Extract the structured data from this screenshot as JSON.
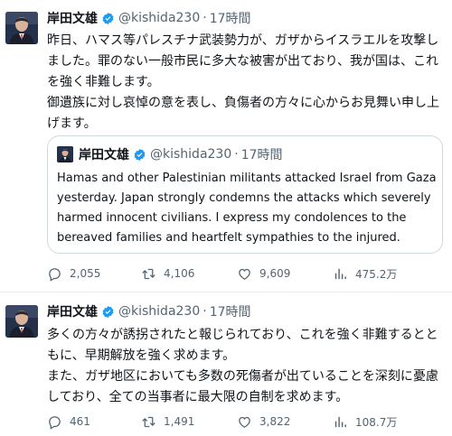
{
  "tweets": [
    {
      "author": {
        "name": "岸田文雄",
        "handle": "@kishida230",
        "time": "17時間"
      },
      "paragraphs": [
        "昨日、ハマス等パレスチナ武装勢力が、ガザからイスラエルを攻撃しました。罪のない一般市民に多大な被害が出ており、我が国は、これを強く非難します。",
        "御遺族に対し哀悼の意を表し、負傷者の方々に心からお見舞い申し上げます。"
      ],
      "quote": {
        "author": {
          "name": "岸田文雄",
          "handle": "@kishida230",
          "time": "17時間"
        },
        "text": "Hamas and other Palestinian militants attacked Israel from Gaza yesterday. Japan strongly condemns the attacks which severely harmed innocent civilians. I express my condolences to the bereaved families and heartfelt sympathies to the injured."
      },
      "stats": {
        "replies": "2,055",
        "retweets": "4,106",
        "likes": "9,609",
        "views": "475.2万"
      }
    },
    {
      "author": {
        "name": "岸田文雄",
        "handle": "@kishida230",
        "time": "17時間"
      },
      "paragraphs": [
        "多くの方々が誘拐されたと報じられており、これを強く非難するとともに、早期解放を強く求めます。",
        "また、ガザ地区においても多数の死傷者が出ていることを深刻に憂慮しており、全ての当事者に最大限の自制を求めます。"
      ],
      "stats": {
        "replies": "461",
        "retweets": "1,491",
        "likes": "3,822",
        "views": "108.7万"
      }
    }
  ],
  "icons": {
    "verified": "verified-badge-icon",
    "reply": "reply-icon",
    "retweet": "retweet-icon",
    "like": "like-icon",
    "views": "views-icon"
  },
  "colors": {
    "text": "#0f1419",
    "secondary": "#536471",
    "verified": "#1d9bf0",
    "border": "#cfd9de"
  },
  "dot": "·"
}
